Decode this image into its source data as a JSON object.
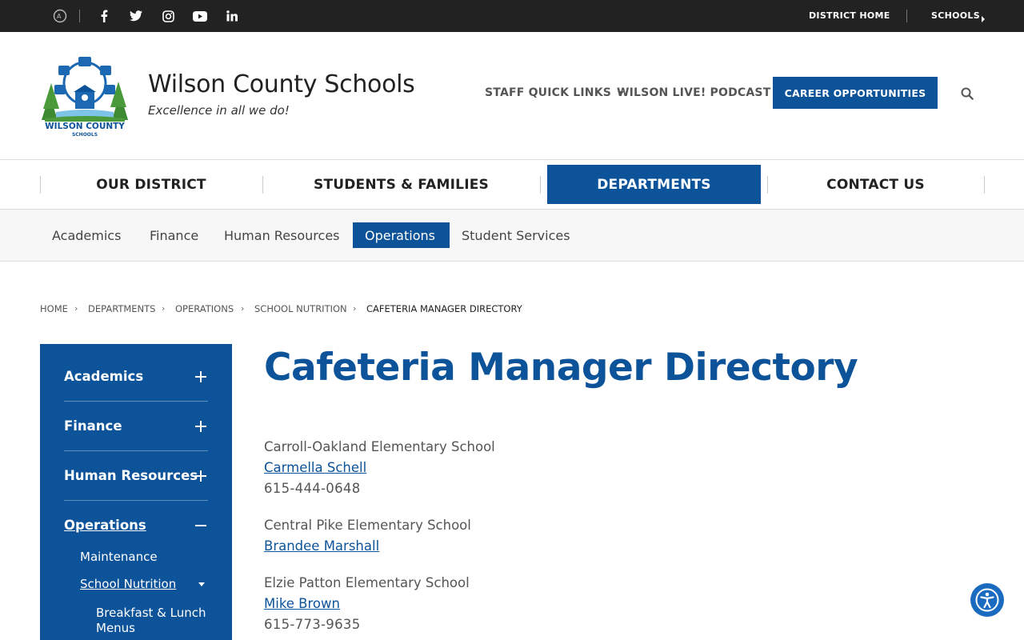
{
  "topbar": {
    "social_icons": [
      "translate-icon",
      "facebook-icon",
      "twitter-icon",
      "instagram-icon",
      "youtube-icon",
      "linkedin-icon"
    ],
    "district_home": "DISTRICT HOME",
    "schools": "SCHOOLS"
  },
  "header": {
    "logo_text": "WILSON COUNTY SCHOOLS",
    "site_name": "Wilson County Schools",
    "tagline": "Excellence in all we do!",
    "staff_quick_links": "STAFF QUICK LINKS",
    "podcast": "WILSON LIVE! PODCAST",
    "career": "CAREER OPPORTUNITIES"
  },
  "main_nav": [
    "OUR DISTRICT",
    "STUDENTS & FAMILIES",
    "DEPARTMENTS",
    "CONTACT US"
  ],
  "main_nav_active": "DEPARTMENTS",
  "sub_nav": [
    "Academics",
    "Finance",
    "Human Resources",
    "Operations",
    "Student Services"
  ],
  "sub_nav_active": "Operations",
  "breadcrumb": [
    "HOME",
    "DEPARTMENTS",
    "OPERATIONS",
    "SCHOOL NUTRITION",
    "CAFETERIA MANAGER DIRECTORY"
  ],
  "sidebar": {
    "items": [
      "Academics",
      "Finance",
      "Human Resources",
      "Operations"
    ],
    "sub_items": [
      "Maintenance",
      "School Nutrition"
    ],
    "sub_sub_items": [
      "Breakfast & Lunch",
      "Menus"
    ]
  },
  "page_title": "Cafeteria Manager Directory",
  "directory": [
    {
      "school": "Carroll-Oakland Elementary School",
      "manager": "Carmella Schell",
      "phone": "615-444-0648"
    },
    {
      "school": "Central Pike Elementary School",
      "manager": "Brandee Marshall",
      "phone": ""
    },
    {
      "school": "Elzie Patton Elementary School",
      "manager": "Mike Brown",
      "phone": "615-773-9635"
    }
  ],
  "colors": {
    "brand": "#0d5399",
    "topbar": "#222222"
  }
}
